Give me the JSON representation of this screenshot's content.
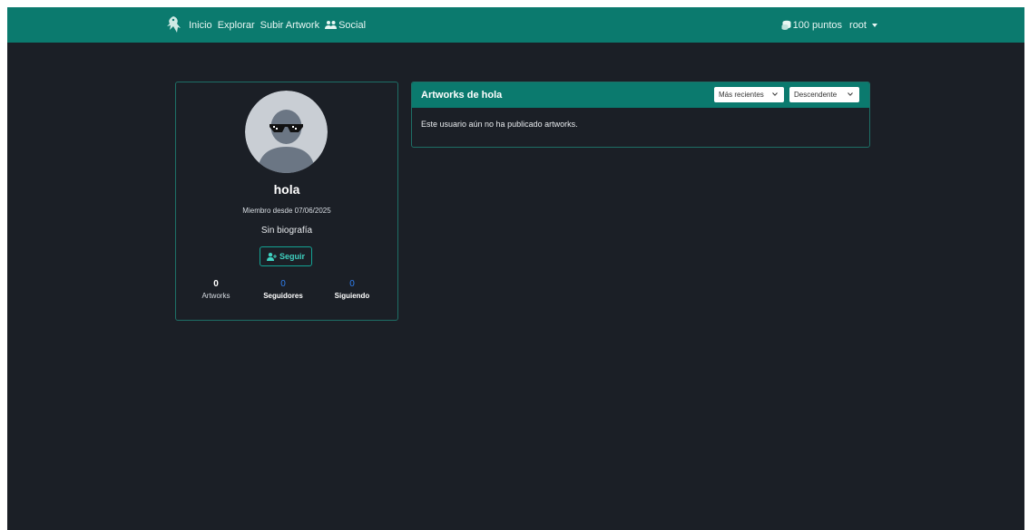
{
  "navbar": {
    "brand_icon": "brand-logo-icon",
    "links": [
      "Inicio",
      "Explorar",
      "Subir Artwork",
      "Social"
    ],
    "social_icon": "users-icon",
    "points_icon": "coins-icon",
    "points_label": "100 puntos",
    "user": "root"
  },
  "profile": {
    "avatar_icon": "avatar-sunglasses-icon",
    "username": "hola",
    "member_since": "Miembro desde 07/06/2025",
    "bio": "Sin biografía",
    "follow_icon": "user-plus-icon",
    "follow_label": "Seguir",
    "stats": [
      {
        "value": "0",
        "label": "Artworks"
      },
      {
        "value": "0",
        "label": "Seguidores"
      },
      {
        "value": "0",
        "label": "Siguiendo"
      }
    ]
  },
  "artworks": {
    "title": "Artworks de hola",
    "sort_value": "Más recientes",
    "order_value": "Descendente",
    "empty_message": "Este usuario aún no ha publicado artworks."
  },
  "colors": {
    "accent": "#0b7a6e",
    "background": "#1b1f26",
    "link_blue": "#2f7ff0"
  }
}
